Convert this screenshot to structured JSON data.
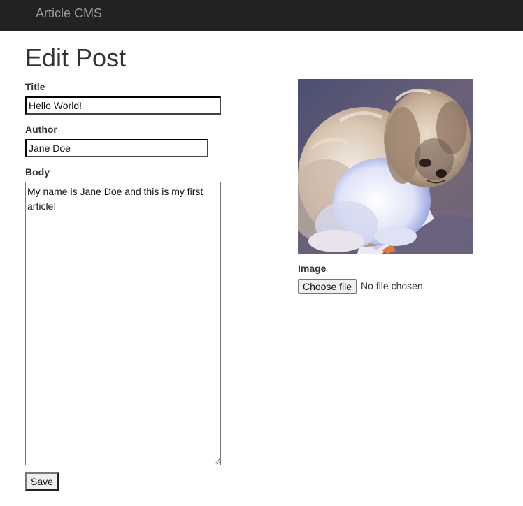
{
  "navbar": {
    "brand": "Article CMS"
  },
  "page": {
    "title": "Edit Post"
  },
  "form": {
    "title_label": "Title",
    "title_value": "Hello World!",
    "author_label": "Author",
    "author_value": "Jane Doe",
    "body_label": "Body",
    "body_value": "My name is Jane Doe and this is my first article!",
    "save_label": "Save",
    "image_label": "Image",
    "file_button_label": "Choose file",
    "file_status": "No file chosen"
  },
  "image_preview": {
    "subject": "photo of a sleeping shih tzu dog",
    "icon": "dog-photo"
  },
  "colors": {
    "navbar_bg": "#222222",
    "brand_text": "#9d9d9d",
    "text": "#333333"
  }
}
